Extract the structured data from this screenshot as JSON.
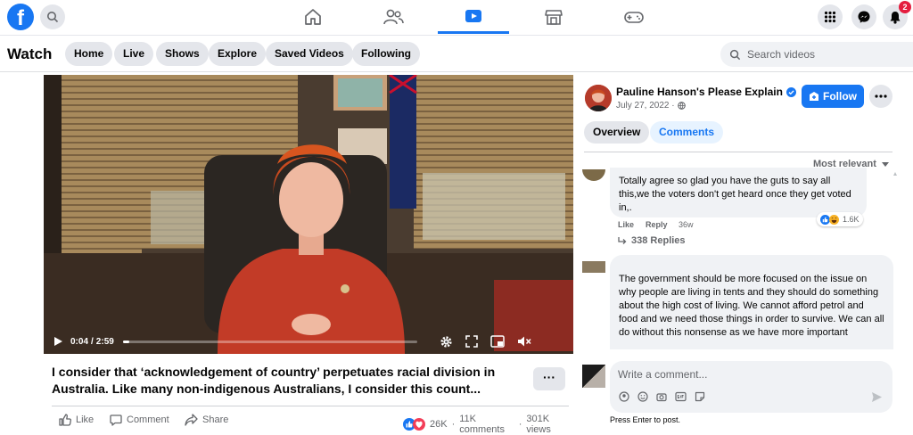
{
  "topbar": {
    "logo_letter": "f",
    "notification_count": "2"
  },
  "subnav": {
    "title": "Watch",
    "pills": [
      "Home",
      "Live",
      "Shows",
      "Explore",
      "Saved Videos",
      "Following"
    ],
    "search_placeholder": "Search videos"
  },
  "video": {
    "current_time": "0:04",
    "duration": "2:59",
    "progress_fraction": 0.022
  },
  "post": {
    "caption": "I consider that ‘acknowledgement of country’ perpetuates racial division in Australia. Like many non-indigenous Australians, I consider this count...",
    "more_label": "···",
    "like_label": "Like",
    "comment_label": "Comment",
    "share_label": "Share",
    "reaction_count": "26K",
    "comments_count": "11K comments",
    "views_count": "301K views",
    "stats_separator": "·"
  },
  "page": {
    "name": "Pauline Hanson's Please Explain",
    "date": "July 27, 2022 ·",
    "follow_label": "Follow",
    "tabs": [
      "Overview",
      "Comments"
    ],
    "sort_label": "Most relevant"
  },
  "comments": [
    {
      "text": "Totally agree so glad you have the guts to say all this,we the voters don't get heard once they get voted in,.",
      "like": "Like",
      "reply": "Reply",
      "age": "36w",
      "reactions": "1.6K",
      "replies": "338 Replies"
    },
    {
      "text": "The government should be more focused on the issue on why people are living in tents and they should do something about the high cost of living. We cannot afford petrol and food and we need those things in order to survive. We can all do without this nonsense as we have more important"
    }
  ],
  "composer": {
    "placeholder": "Write a comment...",
    "hint": "Press Enter to post."
  },
  "colors": {
    "accent": "#1877f2",
    "notification": "#e41e3f"
  }
}
